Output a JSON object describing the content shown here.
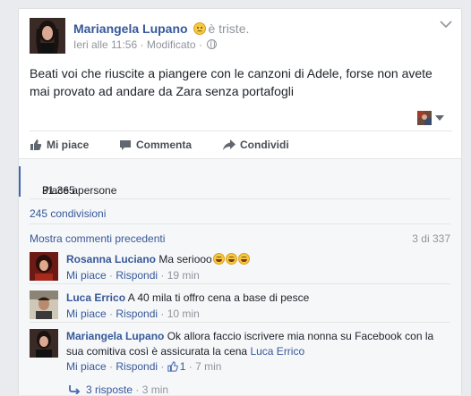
{
  "post": {
    "author": "Mariangela Lupano",
    "feeling": "è triste.",
    "time": "Ieri alle 11:56",
    "separator": "·",
    "edited": "Modificato",
    "text": "Beati voi che riuscite a piangere con le canzoni di Adele, forse non avete mai provato ad andare da Zara senza portafogli"
  },
  "actions": {
    "like": "Mi piace",
    "comment": "Commenta",
    "share": "Condividi"
  },
  "ufi": {
    "likes_prefix": "Piace a",
    "likes_count": "31.365 persone",
    "likes_suffix": ".",
    "shares": "245 condivisioni",
    "prev_comments": "Mostra commenti precedenti",
    "comment_counter": "3 di 337"
  },
  "comments": [
    {
      "author": "Rosanna Luciano",
      "text": "Ma seriooo",
      "emoji_count": 3,
      "like": "Mi piace",
      "reply": "Rispondi",
      "time": "19 min"
    },
    {
      "author": "Luca Errico",
      "text": "A 40 mila ti offro cena a base di pesce",
      "like": "Mi piace",
      "reply": "Rispondi",
      "time": "10 min"
    },
    {
      "author": "Mariangela Lupano",
      "text": "Ok allora faccio iscrivere mia nonna su Facebook con la sua comitiva così è assicurata la cena",
      "mention": "Luca Errico",
      "like": "Mi piace",
      "reply": "Rispondi",
      "reactions": "1",
      "time": "7 min"
    }
  ],
  "replies": {
    "label": "3 risposte",
    "time": "3 min"
  },
  "colors": {
    "link": "#365899",
    "muted": "#90949c",
    "accent": "#4267b2",
    "ufi_bg": "#f6f7f9"
  },
  "icons": [
    "sad-face-icon",
    "globe-icon",
    "chevron-down-icon",
    "like-thumb-icon",
    "comment-icon",
    "share-arrow-icon",
    "reply-arrow-icon",
    "grin-emoji-icon"
  ]
}
